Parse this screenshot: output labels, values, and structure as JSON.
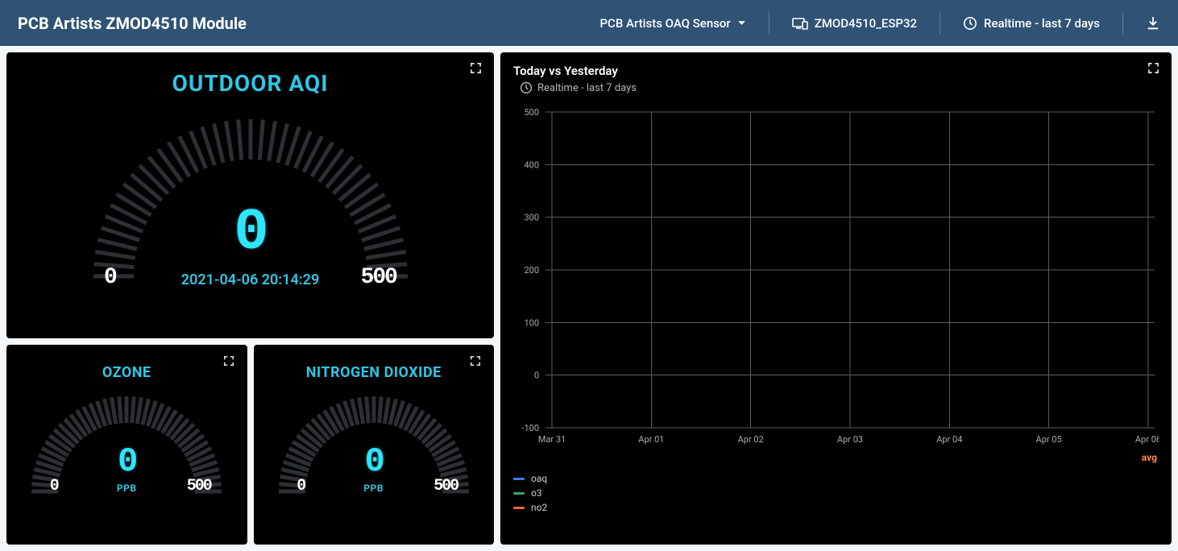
{
  "header": {
    "title": "PCB Artists ZMOD4510 Module",
    "sensor_select": "PCB Artists OAQ Sensor",
    "device": "ZMOD4510_ESP32",
    "range": "Realtime - last 7 days"
  },
  "gauges": {
    "aqi": {
      "title": "OUTDOOR AQI",
      "value": "0",
      "min": "0",
      "max": "500",
      "timestamp": "2021-04-06 20:14:29"
    },
    "ozone": {
      "title": "OZONE",
      "value": "0",
      "min": "0",
      "max": "500",
      "unit": "PPB"
    },
    "no2": {
      "title": "NITROGEN DIOXIDE",
      "value": "0",
      "min": "0",
      "max": "500",
      "unit": "PPB"
    }
  },
  "chart": {
    "title": "Today vs Yesterday",
    "subtitle": "Realtime - last 7 days",
    "avg_label": "avg",
    "legend": [
      {
        "name": "oaq",
        "color": "#3b7cf0"
      },
      {
        "name": "o3",
        "color": "#2fa866"
      },
      {
        "name": "no2",
        "color": "#f0643c"
      }
    ]
  },
  "chart_data": {
    "type": "line",
    "title": "Today vs Yesterday",
    "xlabel": "",
    "ylabel": "",
    "ylim": [
      -100,
      500
    ],
    "y_ticks": [
      -100,
      0,
      100,
      200,
      300,
      400,
      500
    ],
    "x_ticks": [
      "Mar 31",
      "Apr 01",
      "Apr 02",
      "Apr 03",
      "Apr 04",
      "Apr 05",
      "Apr 06"
    ],
    "series": [
      {
        "name": "oaq",
        "color": "#3b7cf0",
        "values": []
      },
      {
        "name": "o3",
        "color": "#2fa866",
        "values": []
      },
      {
        "name": "no2",
        "color": "#f0643c",
        "values": []
      }
    ]
  }
}
